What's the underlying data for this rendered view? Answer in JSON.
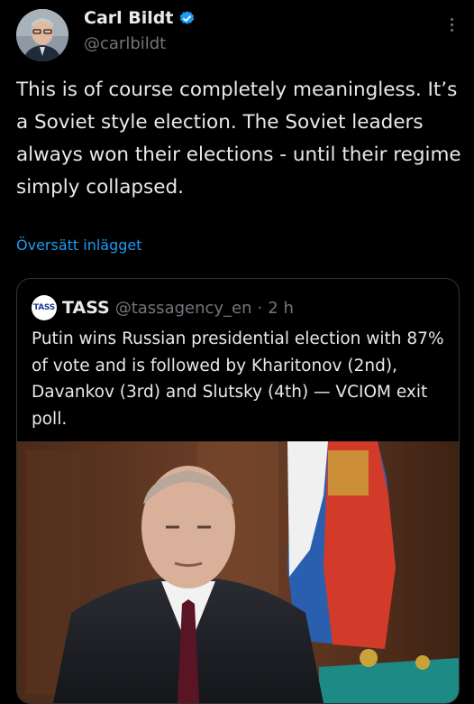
{
  "author": {
    "name": "Carl Bildt",
    "handle": "@carlbildt",
    "avatar_icon": "profile-photo",
    "verified_icon": "verified-badge-icon",
    "verified_color": "#1d9bf0"
  },
  "tweet": {
    "text": "This is of course completely meaningless. It’s a Soviet style election. The Soviet leaders always won their elections - until their regime simply collapsed.",
    "translate_label": "Översätt inlägget"
  },
  "quoted_tweet": {
    "logo_text": "TASS",
    "name": "TASS",
    "handle": "@tassagency_en",
    "separator": "·",
    "time": "2 h",
    "text": "Putin wins Russian presidential election with 87% of vote and is followed by Kharitonov (2nd), Davankov (3rd) and Slutsky (4th) — VCIOM exit poll."
  },
  "colors": {
    "background": "#000000",
    "text": "#e7e9ea",
    "secondary": "#71767b",
    "link": "#1d9bf0",
    "border": "#2f3336"
  }
}
